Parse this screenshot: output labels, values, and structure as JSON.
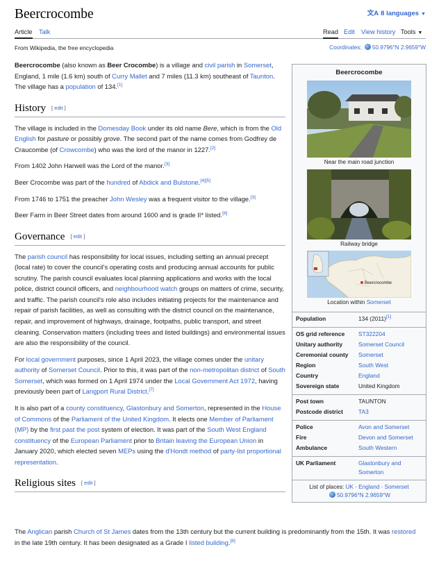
{
  "header": {
    "title": "Beercrocombe",
    "languages": "8 languages"
  },
  "tabs": {
    "article": "Article",
    "talk": "Talk",
    "read": "Read",
    "edit": "Edit",
    "history": "View history",
    "tools": "Tools"
  },
  "from": "From Wikipedia, the free encyclopedia",
  "coords": {
    "label": "Coordinates:",
    "value": "50.9796°N 2.9659°W"
  },
  "intro": {
    "t1": "Beercrocombe",
    "t2": " (also known as ",
    "t3": "Beer Crocombe",
    "t4": ") is a village and ",
    "l1": "civil parish",
    "t5": " in ",
    "l2": "Somerset",
    "t6": ", England, 1 mile (1.6 km) south of ",
    "l3": "Curry Mallet",
    "t7": " and 7 miles (11.3 km) southeast of ",
    "l4": "Taunton",
    "t8": ". The village has a ",
    "l5": "population",
    "t9": " of 134.",
    "ref": "[1]"
  },
  "edit_label": "edit",
  "history": {
    "heading": "History",
    "p1": {
      "t1": "The village is included in the ",
      "l1": "Domesday Book",
      "t2": " under its old name ",
      "i1": "Bere",
      "t3": ", which is from the ",
      "l2": "Old English",
      "t4": " for ",
      "i2": "pasture",
      "t5": " or possibly ",
      "i3": "grove",
      "t6": ". The second part of the name comes from Godfrey de Craucombe (of ",
      "l3": "Crowcombe",
      "t7": ") who was the lord of the manor in 1227.",
      "ref": "[2]"
    },
    "p2": {
      "t1": "From 1402 John Harwell was the Lord of the manor.",
      "ref": "[3]"
    },
    "p3": {
      "t1": "Beer Crocombe was part of the ",
      "l1": "hundred",
      "t2": " of ",
      "l2": "Abdick and Bulstone",
      "t3": ".",
      "ref": "[4][5]"
    },
    "p4": {
      "t1": "From 1746 to 1751 the preacher ",
      "l1": "John Wesley",
      "t2": " was a frequent visitor to the village.",
      "ref": "[3]"
    },
    "p5": {
      "t1": "Beer Farm in Beer Street dates from around 1600 and is grade II* listed.",
      "ref": "[6]"
    }
  },
  "governance": {
    "heading": "Governance",
    "p1": {
      "t1": "The ",
      "l1": "parish council",
      "t2": " has responsibility for local issues, including setting an annual precept (local rate) to cover the council's operating costs and producing annual accounts for public scrutiny. The parish council evaluates local planning applications and works with the local police, district council officers, and ",
      "l2": "neighbourhood watch",
      "t3": " groups on matters of crime, security, and traffic. The parish council's role also includes initiating projects for the maintenance and repair of parish facilities, as well as consulting with the district council on the maintenance, repair, and improvement of highways, drainage, footpaths, public transport, and street cleaning. Conservation matters (including trees and listed buildings) and environmental issues are also the responsibility of the council."
    },
    "p2": {
      "t1": "For ",
      "l1": "local government",
      "t2": " purposes, since 1 April 2023, the village comes under the ",
      "l2": "unitary authority",
      "t3": " of ",
      "l3": "Somerset Council",
      "t4": ". Prior to this, it was part of the ",
      "l4": "non-metropolitan district",
      "t5": " of ",
      "l5": "South Somerset",
      "t6": ", which was formed on 1 April 1974 under the ",
      "l6": "Local Government Act 1972",
      "t7": ", having previously been part of ",
      "l7": "Langport Rural District",
      "t8": ".",
      "ref": "[7]"
    },
    "p3": {
      "t1": "It is also part of a ",
      "l1": "county constituency",
      "t2": ", ",
      "l2": "Glastonbury and Somerton",
      "t3": ", represented in the ",
      "l3": "House of Commons",
      "t4": " of the ",
      "l4": "Parliament of the United Kingdom",
      "t5": ". It elects one ",
      "l5": "Member of Parliament (MP)",
      "t6": " by the ",
      "l6": "first past the post",
      "t7": " system of election. It was part of the ",
      "l7": "South West England constituency",
      "t8": " of the ",
      "l8": "European Parliament",
      "t9": " prior to ",
      "l9": "Britain leaving the European Union",
      "t10": " in January 2020, which elected seven ",
      "l10": "MEPs",
      "t11": " using the ",
      "l11": "d'Hondt method",
      "t12": " of ",
      "l12": "party-list proportional representation",
      "t13": "."
    }
  },
  "religious": {
    "heading": "Religious sites",
    "p1": {
      "t1": "The ",
      "l1": "Anglican",
      "t2": " parish ",
      "l2": "Church of St James",
      "t3": " dates from the 13th century but the current building is predominantly from the 15th. It was ",
      "l3": "restored",
      "t4": " in the late 19th century. It has been designated as a Grade I ",
      "l4": "listed building",
      "t5": ".",
      "ref": "[8]"
    }
  },
  "infobox": {
    "title": "Beercrocombe",
    "img1_caption": "Near the main road junction",
    "img2_caption": "Railway bridge",
    "map_label": "Beercrocombe",
    "map_caption": "Location within ",
    "map_caption_link": "Somerset",
    "population": {
      "k": "Population",
      "v": "134 (2011)",
      "ref": "[1]"
    },
    "rows1": [
      {
        "k": "OS grid reference",
        "v": "ST322204"
      },
      {
        "k": "Unitary authority",
        "v": "Somerset Council"
      },
      {
        "k": "Ceremonial county",
        "v": "Somerset"
      },
      {
        "k": "Region",
        "v": "South West"
      },
      {
        "k": "Country",
        "v": "England"
      },
      {
        "k": "Sovereign state",
        "v": "United Kingdom"
      }
    ],
    "rows2": [
      {
        "k": "Post town",
        "v": "TAUNTON"
      },
      {
        "k": "Postcode district",
        "v": "TA3"
      }
    ],
    "rows3": [
      {
        "k": "Police",
        "v": "Avon and Somerset"
      },
      {
        "k": "Fire",
        "v": "Devon and Somerset"
      },
      {
        "k": "Ambulance",
        "v": "South Western"
      }
    ],
    "rows4": [
      {
        "k": "UK Parliament",
        "v": "Glastonbury and Somerton"
      }
    ],
    "foot": {
      "label": "List of places: ",
      "l1": "UK",
      "l2": "England",
      "l3": "Somerset",
      "dot": " · ",
      "coords": "50.9796°N 2.9659°W"
    }
  }
}
